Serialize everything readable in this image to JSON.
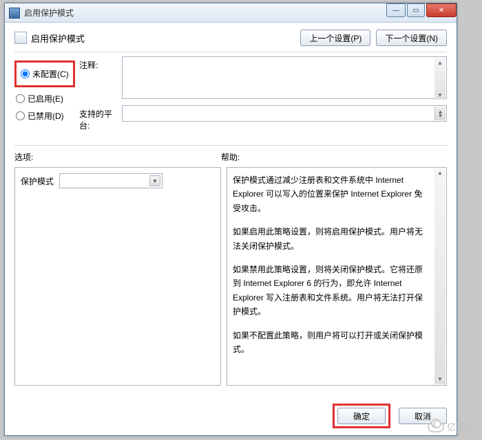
{
  "window": {
    "title": "启用保护模式"
  },
  "header": {
    "policy_title": "启用保护模式",
    "prev_btn": "上一个设置(P)",
    "next_btn": "下一个设置(N)"
  },
  "radios": {
    "not_configured": "未配置(C)",
    "enabled": "已启用(E)",
    "disabled": "已禁用(D)",
    "selected": "not_configured"
  },
  "fields": {
    "comment_label": "注释:",
    "comment_value": "",
    "platform_label": "支持的平台:",
    "platform_value": ""
  },
  "columns": {
    "options_label": "选项:",
    "help_label": "帮助:"
  },
  "options": {
    "mode_label": "保护模式",
    "mode_value": ""
  },
  "help": {
    "p1": "保护模式通过减少注册表和文件系统中 Internet Explorer 可以写入的位置来保护 Internet Explorer 免受攻击。",
    "p2": "如果启用此策略设置，则将启用保护模式。用户将无法关闭保护模式。",
    "p3": "如果禁用此策略设置，则将关闭保护模式。它将还原到 Internet Explorer 6 的行为，即允许 Internet Explorer 写入注册表和文件系统。用户将无法打开保护模式。",
    "p4": "如果不配置此策略，则用户将可以打开或关闭保护模式。"
  },
  "footer": {
    "ok": "确定",
    "cancel": "取消"
  },
  "watermark": "亿速云"
}
